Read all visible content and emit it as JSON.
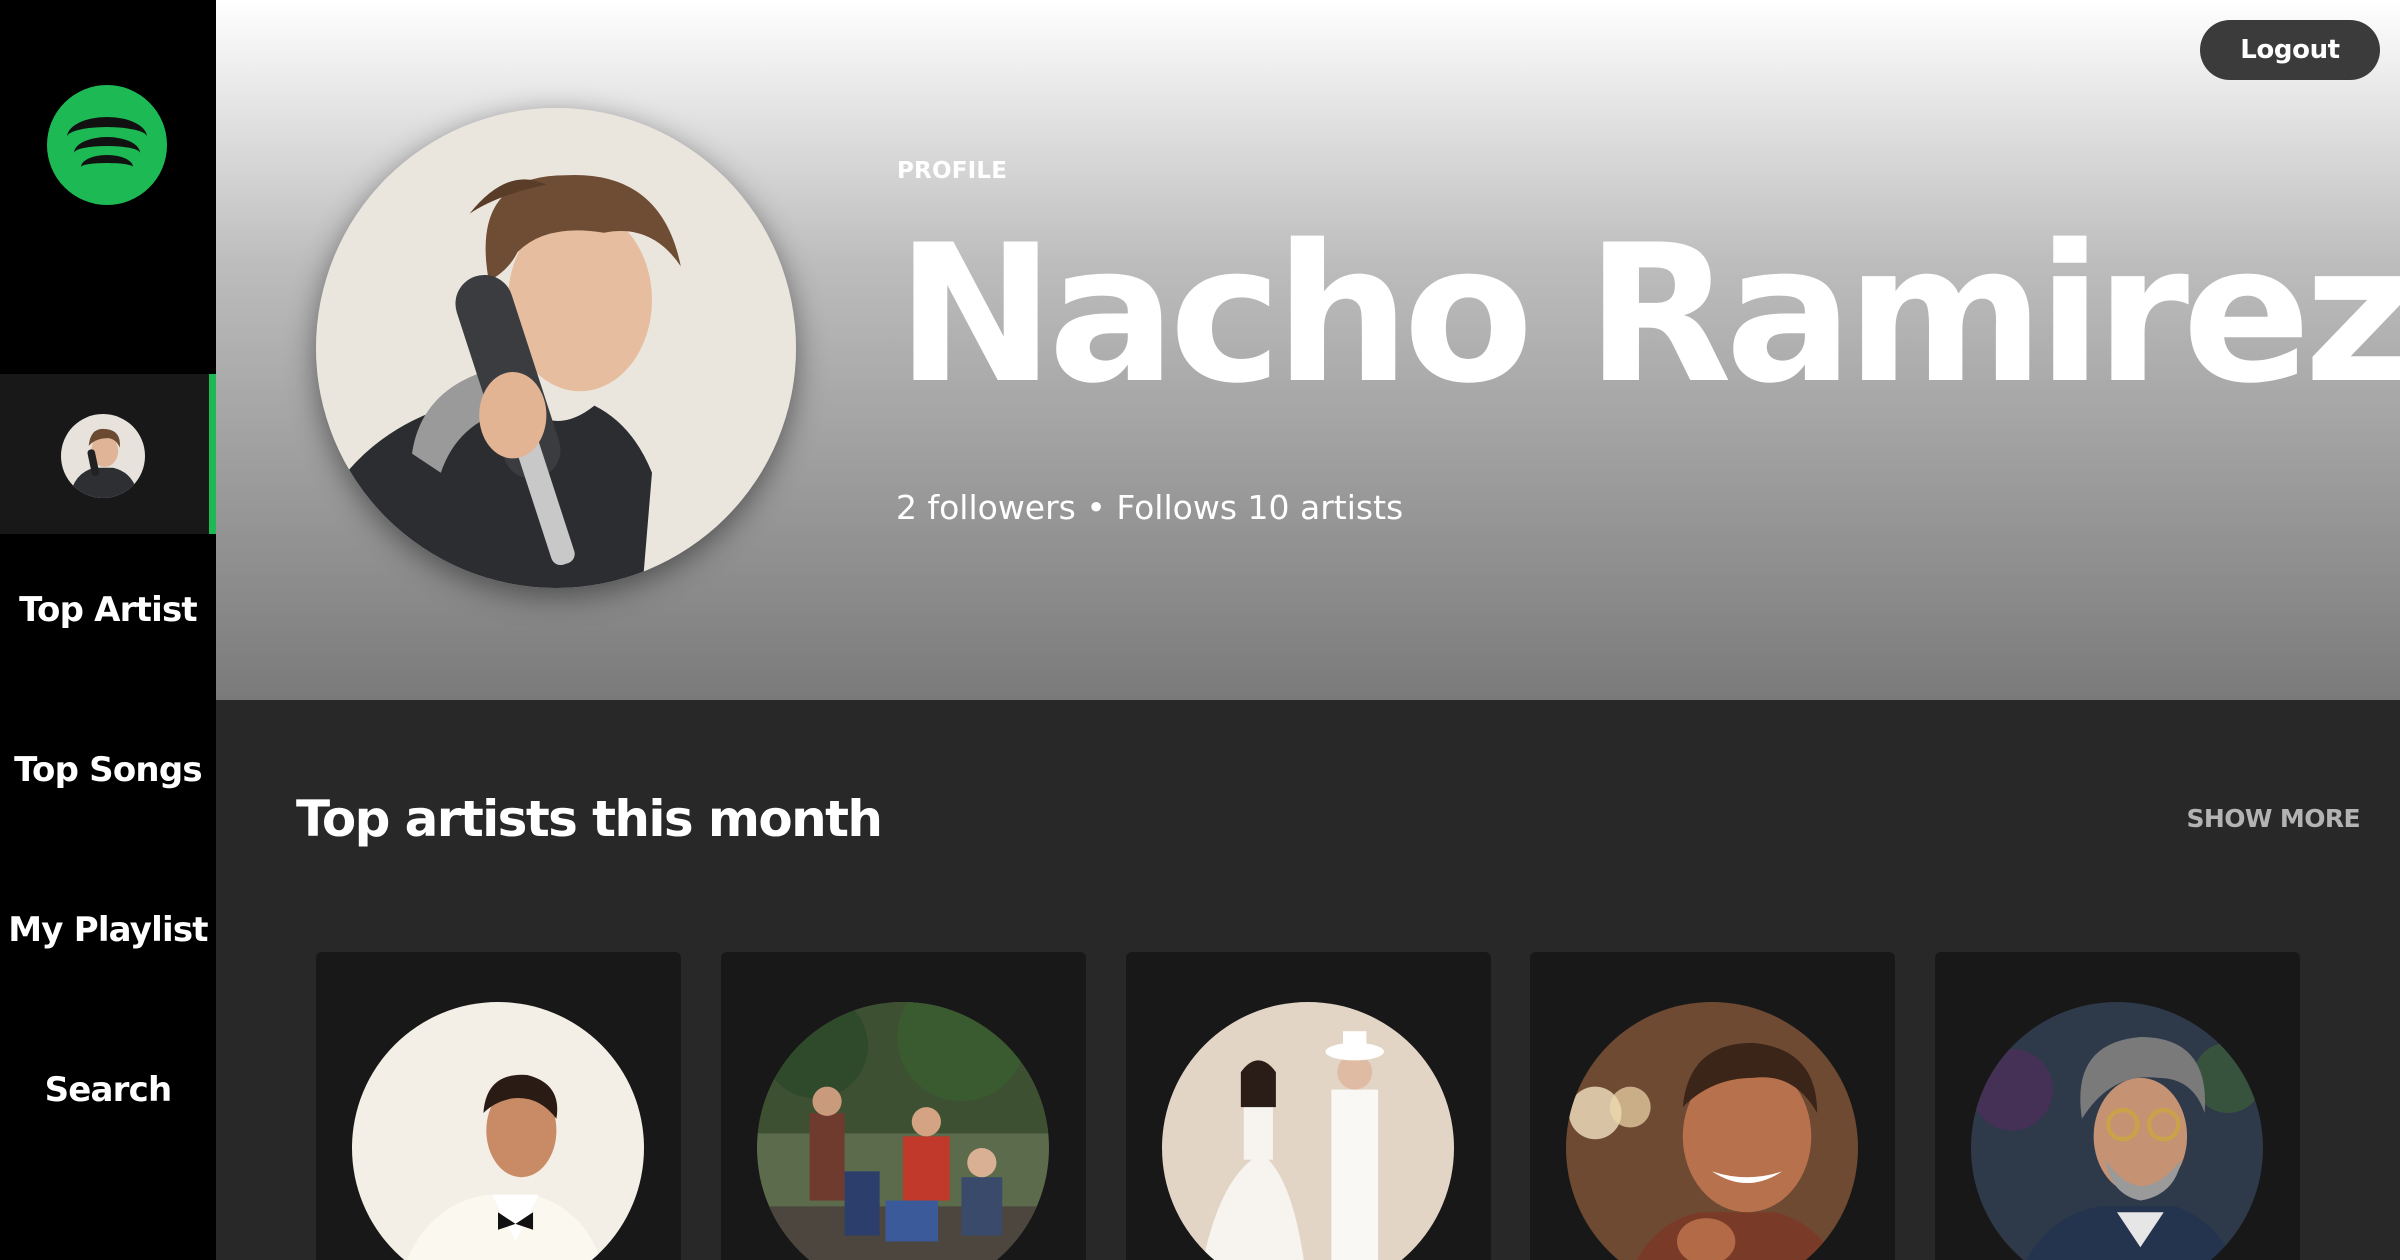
{
  "sidebar": {
    "logo_icon": "spotify-logo-icon",
    "brand_color": "#1db954",
    "nav": {
      "top_artist": "Top Artist",
      "top_songs": "Top Songs",
      "my_playlist": "My Playlist",
      "search": "Search"
    }
  },
  "header": {
    "logout_label": "Logout",
    "profile_label": "PROFILE",
    "name": "Nacho Ramirez",
    "stats": "2 followers • Follows 10 artists"
  },
  "main": {
    "section_title": "Top artists this month",
    "show_more_label": "SHOW MORE",
    "artists": [
      {
        "image": "artist-photo"
      },
      {
        "image": "artist-photo"
      },
      {
        "image": "artist-photo"
      },
      {
        "image": "artist-photo"
      },
      {
        "image": "artist-photo"
      }
    ]
  }
}
